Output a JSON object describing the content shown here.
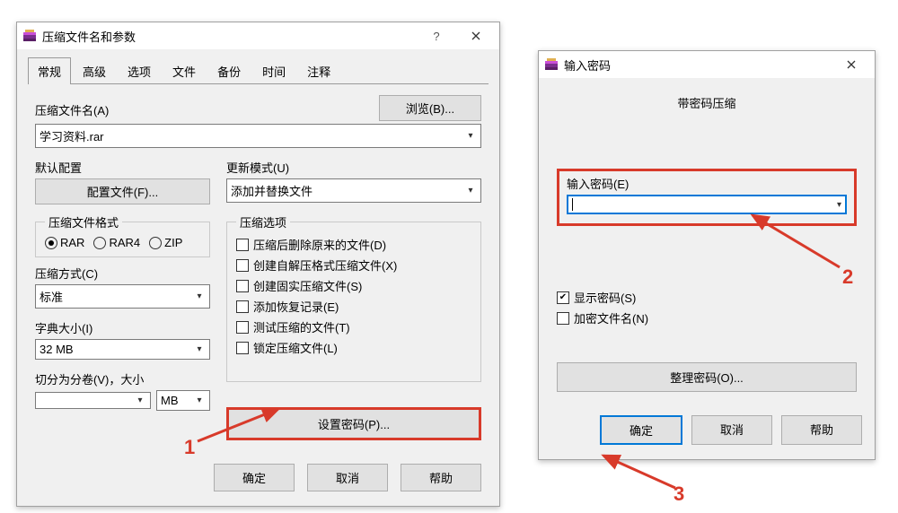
{
  "window1": {
    "title": "压缩文件名和参数",
    "tabs": [
      "常规",
      "高级",
      "选项",
      "文件",
      "备份",
      "时间",
      "注释"
    ],
    "archive_name_label": "压缩文件名(A)",
    "archive_name_value": "学习资料.rar",
    "browse_label": "浏览(B)...",
    "default_profile_label": "默认配置",
    "profile_btn": "配置文件(F)...",
    "update_mode_label": "更新模式(U)",
    "update_mode_value": "添加并替换文件",
    "format_group_label": "压缩文件格式",
    "formats": [
      "RAR",
      "RAR4",
      "ZIP"
    ],
    "options_group_label": "压缩选项",
    "options": [
      "压缩后删除原来的文件(D)",
      "创建自解压格式压缩文件(X)",
      "创建固实压缩文件(S)",
      "添加恢复记录(E)",
      "测试压缩的文件(T)",
      "锁定压缩文件(L)"
    ],
    "method_label": "压缩方式(C)",
    "method_value": "标准",
    "dict_label": "字典大小(I)",
    "dict_value": "32 MB",
    "split_label": "切分为分卷(V)，大小",
    "split_unit": "MB",
    "set_password_btn": "设置密码(P)...",
    "footer": {
      "ok": "确定",
      "cancel": "取消",
      "help": "帮助"
    }
  },
  "window2": {
    "title": "输入密码",
    "heading": "带密码压缩",
    "enter_pw_label": "输入密码(E)",
    "show_pw_label": "显示密码(S)",
    "encrypt_names_label": "加密文件名(N)",
    "manage_pw_btn": "整理密码(O)...",
    "footer": {
      "ok": "确定",
      "cancel": "取消",
      "help": "帮助"
    }
  },
  "annotations": {
    "n1": "1",
    "n2": "2",
    "n3": "3"
  }
}
